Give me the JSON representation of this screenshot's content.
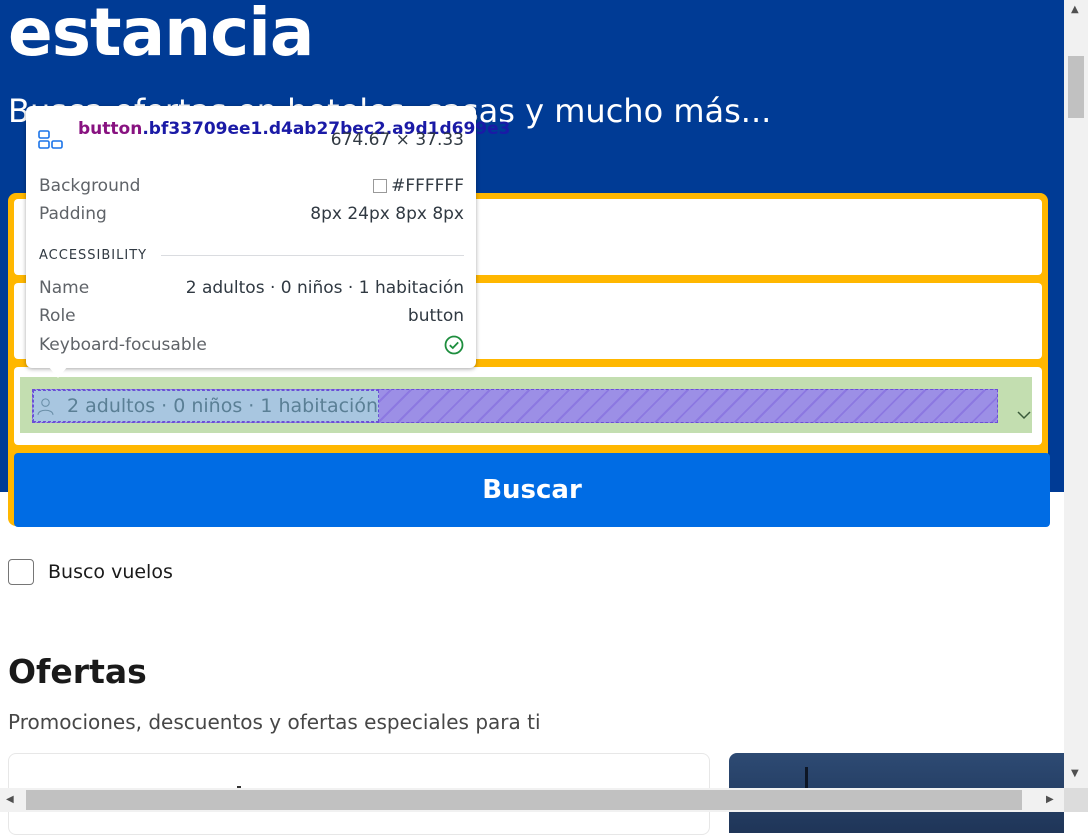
{
  "hero": {
    "title": "estancia",
    "subtitle": "Busca ofertas en hoteles, casas y mucho más..."
  },
  "search": {
    "guests_label": "2 adultos · 0 niños · 1 habitación",
    "submit_label": "Buscar"
  },
  "flights_checkbox": {
    "label": "Busco vuelos",
    "checked": false
  },
  "offers": {
    "title": "Ofertas",
    "subtitle": "Promociones, descuentos y ofertas especiales para ti"
  },
  "inspector": {
    "tag": "button",
    "class_suffix": ".bf33709ee1.d4ab27bec2.a9d1d699e3",
    "size": "674.67 × 37.33",
    "background_label": "Background",
    "background_value": "#FFFFFF",
    "padding_label": "Padding",
    "padding_value": "8px 24px 8px 8px",
    "accessibility_heading": "ACCESSIBILITY",
    "name_label": "Name",
    "name_value": "2 adultos · 0 niños · 1 habitación",
    "role_label": "Role",
    "role_value": "button",
    "focusable_label": "Keyboard-focusable",
    "focusable": true
  },
  "colors": {
    "brand_blue": "#003b95",
    "accent_yellow": "#ffb700",
    "button_blue": "#006ce4"
  },
  "icons": [
    "user-icon",
    "chevron-down-icon",
    "layout-grid-icon",
    "check-circle-icon"
  ]
}
